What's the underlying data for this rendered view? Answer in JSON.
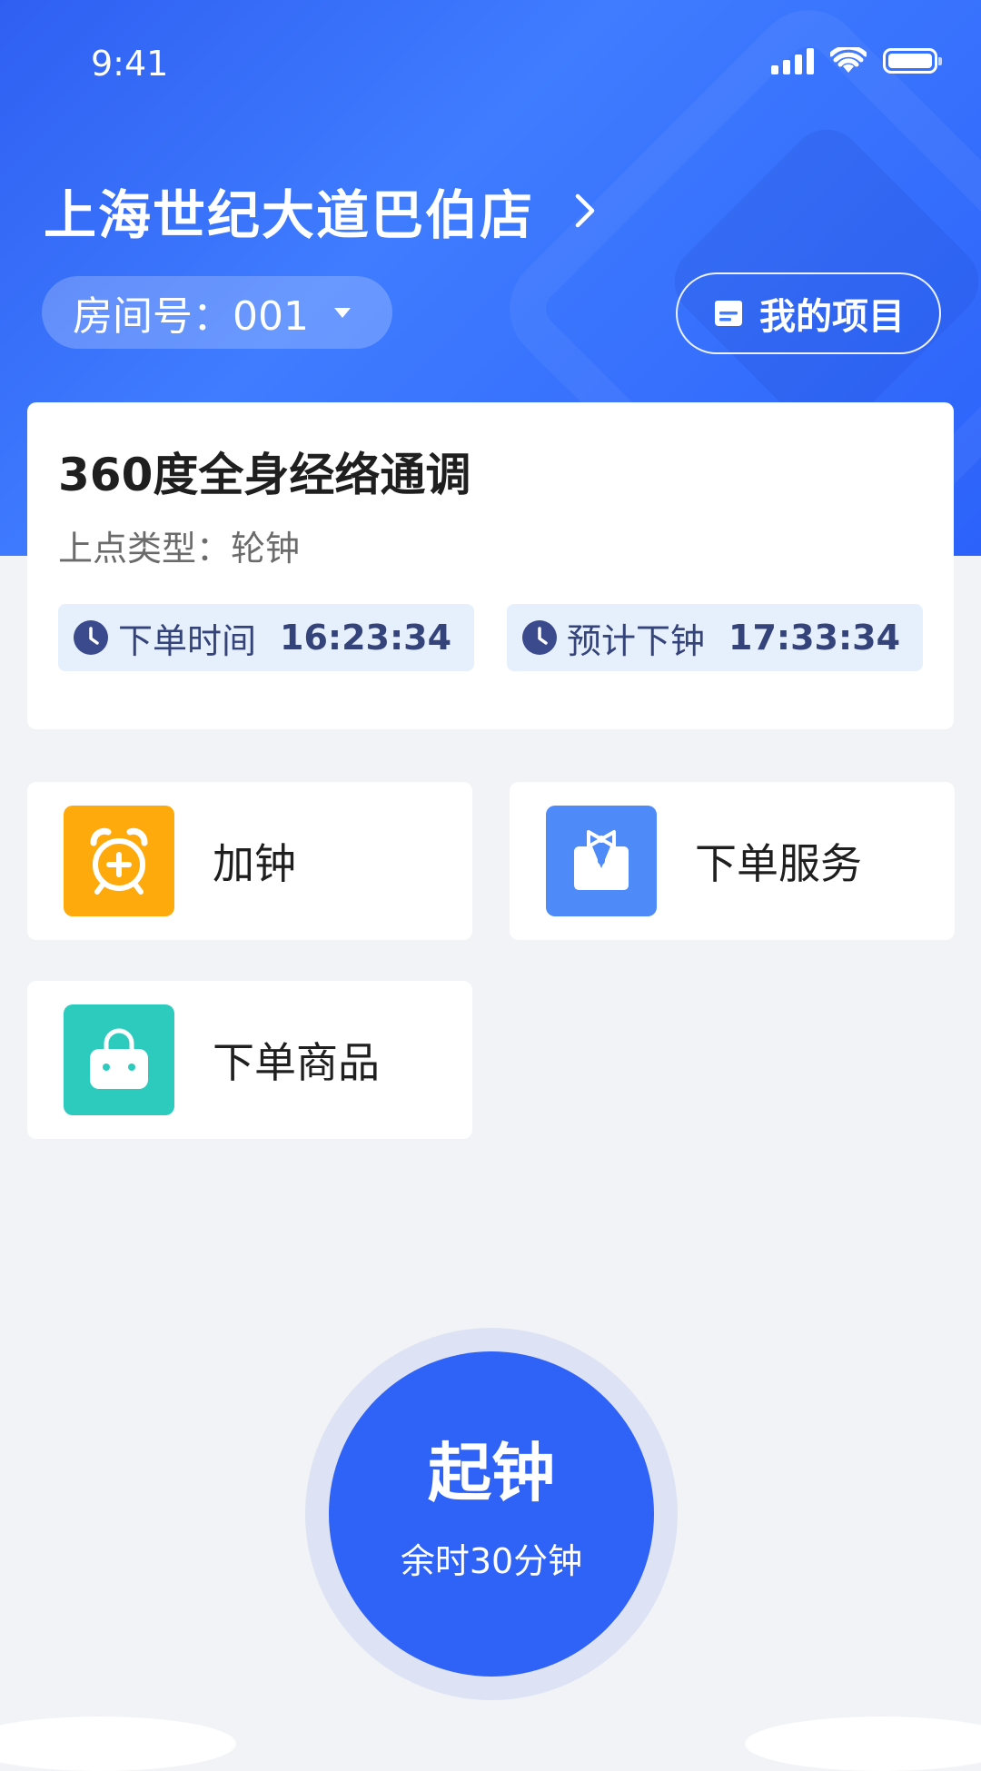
{
  "status_bar": {
    "time": "9:41"
  },
  "header": {
    "store_name": "上海世纪大道巴伯店",
    "room_label": "房间号：001",
    "my_projects_label": "我的项目"
  },
  "project": {
    "name": "360度全身经络通调",
    "type_label": "上点类型：轮钟",
    "order_time_label": "下单时间",
    "order_time_value": "16:23:34",
    "end_time_label": "预计下钟",
    "end_time_value": "17:33:34"
  },
  "actions": [
    {
      "label": "加钟",
      "icon": "alarm-clock-plus-icon",
      "color": "#FFAA0C"
    },
    {
      "label": "下单服务",
      "icon": "waiter-bowtie-icon",
      "color": "#4F8BF8"
    },
    {
      "label": "下单商品",
      "icon": "shopping-bag-icon",
      "color": "#2DCBBE"
    }
  ],
  "start_button": {
    "label": "起钟",
    "remaining": "余时30分钟"
  },
  "colors": {
    "header_blue": "#3F7CFF",
    "primary": "#2F62F6",
    "chip_bg": "#E6EFFC",
    "page_bg": "#F1F3F6"
  }
}
